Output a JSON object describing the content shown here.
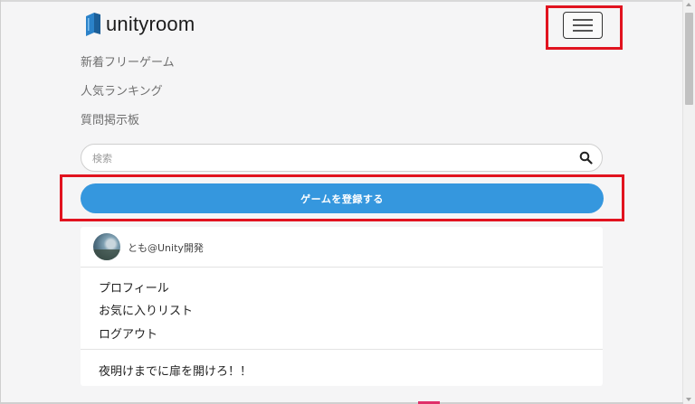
{
  "header": {
    "logo_text": "unityroom",
    "logo_icon": "unityroom-book-icon",
    "menu_icon": "hamburger-menu-icon"
  },
  "nav": {
    "items": [
      {
        "label": "新着フリーゲーム"
      },
      {
        "label": "人気ランキング"
      },
      {
        "label": "質問掲示板"
      }
    ]
  },
  "search": {
    "placeholder": "検索",
    "value": "",
    "icon": "search-icon"
  },
  "register_button": {
    "label": "ゲームを登録する",
    "color": "#3597de"
  },
  "user_menu": {
    "username": "とも@Unity開発",
    "items": [
      {
        "label": "プロフィール"
      },
      {
        "label": "お気に入りリスト"
      },
      {
        "label": "ログアウト"
      }
    ],
    "game": "夜明けまでに扉を開けろ！！"
  },
  "annotations": {
    "highlight_color": "#e1131f"
  }
}
